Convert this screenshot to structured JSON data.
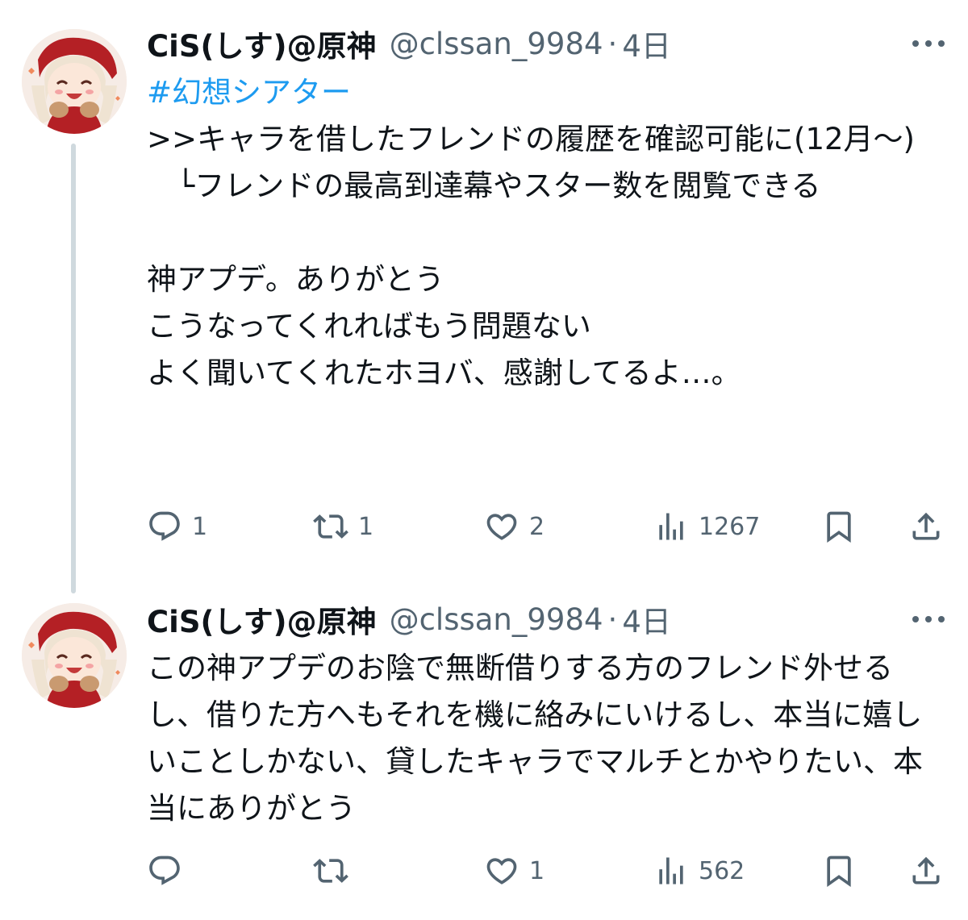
{
  "tweets": [
    {
      "name": "CiS(しす)@原神",
      "handle": "@clssan_9984",
      "separator": "·",
      "time": "4日",
      "hashtag": "#幻想シアター",
      "text": "\n>>キャラを借したフレンドの履歴を確認可能に(12月〜)\n　└フレンドの最高到達幕やスター数を閲覧できる\n\n神アプデ。ありがとう\nこうなってくれればもう問題ない\nよく聞いてくれたホヨバ、感謝してるよ…。",
      "replies": "1",
      "retweets": "1",
      "likes": "2",
      "views": "1267"
    },
    {
      "name": "CiS(しす)@原神",
      "handle": "@clssan_9984",
      "separator": "·",
      "time": "4日",
      "text": "この神アプデのお陰で無断借りする方のフレンド外せるし、借りた方へもそれを機に絡みにいけるし、本当に嬉しいことしかない、貸したキャラでマルチとかやりたい、本当にありがとう",
      "replies": "",
      "retweets": "",
      "likes": "1",
      "views": "562"
    }
  ],
  "colors": {
    "text": "#0f1419",
    "secondary": "#536471",
    "link": "#1d9bf0",
    "thread_line": "#cfd9de"
  },
  "icons": [
    "avatar",
    "more-icon",
    "reply-icon",
    "retweet-icon",
    "like-icon",
    "views-icon",
    "bookmark-icon",
    "share-icon"
  ]
}
